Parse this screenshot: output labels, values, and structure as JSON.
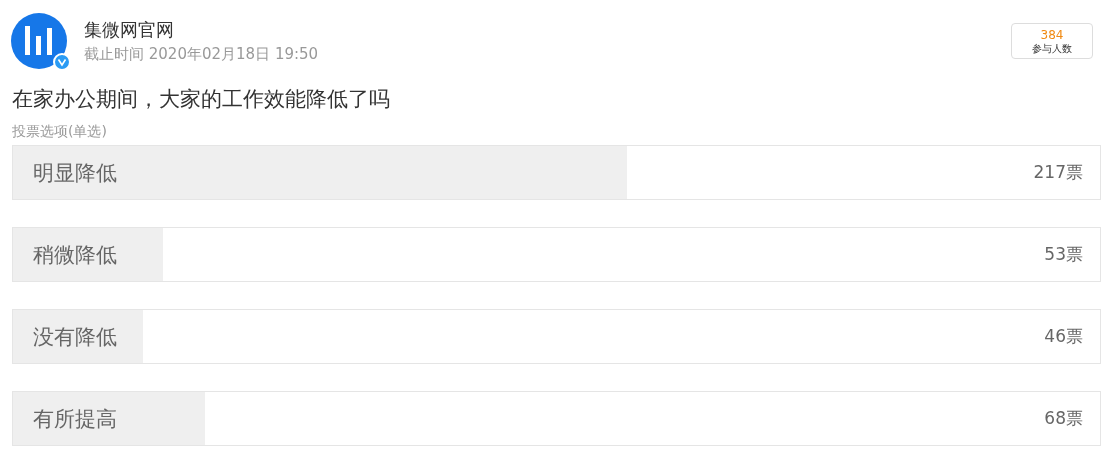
{
  "account": {
    "name": "集微网官网",
    "verified": true,
    "deadline": "截止时间 2020年02月18日 19:50"
  },
  "participants": {
    "count": "384",
    "label": "参与人数"
  },
  "question": "在家办公期间，大家的工作效能降低了吗",
  "mode": "投票选项(单选)",
  "options": [
    {
      "label": "明显降低",
      "level": 0.565,
      "votes": "217票"
    },
    {
      "label": "稍微降低",
      "level": 0.138,
      "votes": "53票"
    },
    {
      "label": "没有降低",
      "level": 0.12,
      "votes": "46票"
    },
    {
      "label": "有所提高",
      "level": 0.177,
      "votes": "68票"
    }
  ]
}
